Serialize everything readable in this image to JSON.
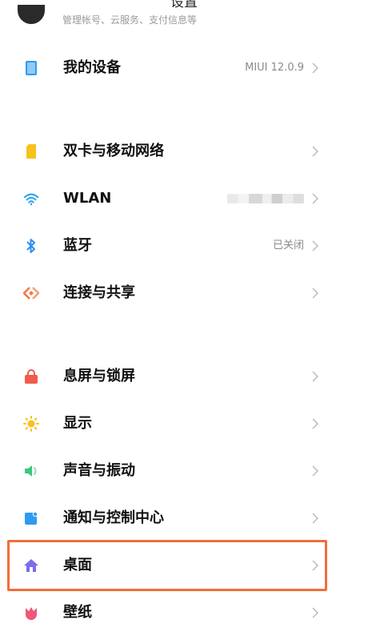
{
  "header": {
    "title": "设置"
  },
  "account": {
    "subtitle": "管理帐号、云服务、支付信息等"
  },
  "items": [
    {
      "key": "my-device",
      "icon": "device-icon",
      "label": "我的设备",
      "value": "MIUI 12.0.9"
    },
    {
      "key": "dual-sim",
      "icon": "sim-card-icon",
      "label": "双卡与移动网络",
      "value": ""
    },
    {
      "key": "wlan",
      "icon": "wifi-icon",
      "label": "WLAN",
      "value": ""
    },
    {
      "key": "bluetooth",
      "icon": "bluetooth-icon",
      "label": "蓝牙",
      "value": "已关闭"
    },
    {
      "key": "connect-share",
      "icon": "share-icon",
      "label": "连接与共享",
      "value": ""
    },
    {
      "key": "lock-screen",
      "icon": "lock-icon",
      "label": "息屏与锁屏",
      "value": ""
    },
    {
      "key": "display",
      "icon": "sun-icon",
      "label": "显示",
      "value": ""
    },
    {
      "key": "sound",
      "icon": "speaker-icon",
      "label": "声音与振动",
      "value": ""
    },
    {
      "key": "notifications",
      "icon": "notification-icon",
      "label": "通知与控制中心",
      "value": ""
    },
    {
      "key": "home-screen",
      "icon": "home-icon",
      "label": "桌面",
      "value": ""
    },
    {
      "key": "wallpaper",
      "icon": "tulip-icon",
      "label": "壁纸",
      "value": ""
    }
  ],
  "colors": {
    "highlight": "#ef6f3a",
    "device": "#2f9bf0",
    "sim": "#f6c21b",
    "wifi": "#27a3f0",
    "bluetooth": "#2d8ff0",
    "share": "#f07a4a",
    "lock": "#f25a4e",
    "sun": "#f6c21b",
    "sound": "#3cc77a",
    "notify": "#2f9bf0",
    "home": "#7b6cf0",
    "wallpaper": "#f0577a"
  }
}
